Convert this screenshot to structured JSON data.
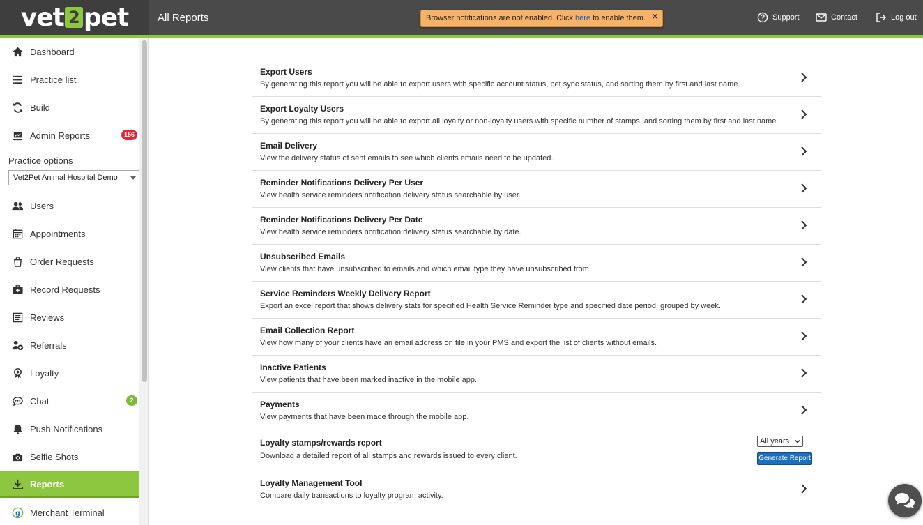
{
  "header": {
    "logo_left": "vet",
    "logo_mid": "2",
    "logo_right": "pet",
    "page_title": "All Reports",
    "notification": {
      "text_before": "Browser notifications are not enabled. Click ",
      "link": "here",
      "text_after": " to enable them.",
      "close": "✕"
    },
    "support": "Support",
    "contact": "Contact",
    "logout": "Log out"
  },
  "sidebar": {
    "items": [
      {
        "label": "Dashboard",
        "icon": "home-icon"
      },
      {
        "label": "Practice list",
        "icon": "list-icon"
      },
      {
        "label": "Build",
        "icon": "refresh-icon"
      },
      {
        "label": "Admin Reports",
        "icon": "admin-reports-icon",
        "badge": "156"
      },
      {
        "label": "Users",
        "icon": "users-icon"
      },
      {
        "label": "Appointments",
        "icon": "calendar-icon"
      },
      {
        "label": "Order Requests",
        "icon": "bag-icon"
      },
      {
        "label": "Record Requests",
        "icon": "medical-kit-icon"
      },
      {
        "label": "Reviews",
        "icon": "reviews-icon"
      },
      {
        "label": "Referrals",
        "icon": "referrals-icon"
      },
      {
        "label": "Loyalty",
        "icon": "ribbon-icon"
      },
      {
        "label": "Chat",
        "icon": "chat-icon",
        "badge": "2"
      },
      {
        "label": "Push Notifications",
        "icon": "bell-icon"
      },
      {
        "label": "Selfie Shots",
        "icon": "camera-icon"
      },
      {
        "label": "Reports",
        "icon": "download-icon"
      },
      {
        "label": "Merchant Terminal",
        "icon": "g-logo-icon"
      }
    ],
    "practice_options_label": "Practice options",
    "practice_selected": "Vet2Pet Animal Hospital Demo"
  },
  "reports": [
    {
      "title": "Export Users",
      "desc": "By generating this report you will be able to export users with specific account status, pet sync status, and sorting them by first and last name."
    },
    {
      "title": "Export Loyalty Users",
      "desc": "By generating this report you will be able to export all loyalty or non-loyalty users with specific number of stamps, and sorting them by first and last name."
    },
    {
      "title": "Email Delivery",
      "desc": "View the delivery status of sent emails to see which clients emails need to be updated."
    },
    {
      "title": "Reminder Notifications Delivery Per User",
      "desc": "View health service reminders notification delivery status searchable by user."
    },
    {
      "title": "Reminder Notifications Delivery Per Date",
      "desc": "View health service reminders notification delivery status searchable by date."
    },
    {
      "title": "Unsubscribed Emails",
      "desc": "View clients that have unsubscribed to emails and which email type they have unsubscribed from."
    },
    {
      "title": "Service Reminders Weekly Delivery Report",
      "desc": "Export an excel report that shows delivery stats for specified Health Service Reminder type and specified date period, grouped by week."
    },
    {
      "title": "Email Collection Report",
      "desc": "View how many of your clients have an email address on file in your PMS and export the list of clients without emails."
    },
    {
      "title": "Inactive Patients",
      "desc": "View patients that have been marked inactive in the mobile app."
    },
    {
      "title": "Payments",
      "desc": "View payments that have been made through the mobile app."
    },
    {
      "title": "Loyalty stamps/rewards report",
      "desc": "Download a detailed report of all stamps and rewards issued to every client."
    },
    {
      "title": "Loyalty Management Tool",
      "desc": "Compare daily transactions to loyalty program activity."
    }
  ],
  "loyalty_report": {
    "year_selected": "All years",
    "generate_label": "Generate Report"
  },
  "colors": {
    "accent": "#8dc63f",
    "header": "#4a4a4a",
    "badge_red": "#e32636",
    "button_blue": "#1a6fbf"
  }
}
